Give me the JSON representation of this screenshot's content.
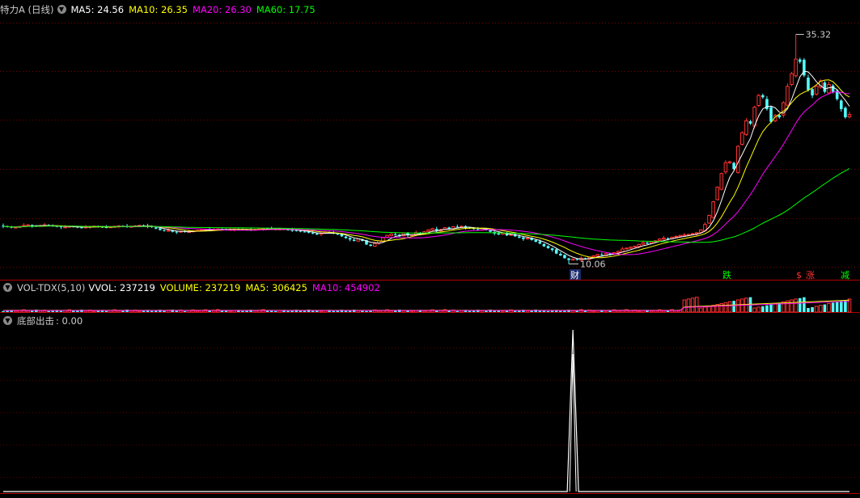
{
  "header": {
    "title": "特力A (日线)",
    "ma5": "MA5: 24.56",
    "ma10": "MA10: 26.35",
    "ma20": "MA20: 26.30",
    "ma60": "MA60: 17.75",
    "colors": {
      "text": "#cccccc",
      "ma5": "#ffffff",
      "ma10": "#ffff00",
      "ma20": "#ff00ff",
      "ma60": "#00ff00"
    }
  },
  "vol_header": {
    "name": "VOL-TDX(5,10)",
    "vvol": "VVOL: 237219",
    "volume": "VOLUME: 237219",
    "ma5": "MA5: 306425",
    "ma10": "MA10: 454902"
  },
  "ind_header": {
    "name": "底部出击",
    "value": ": 0.00"
  },
  "annotations": {
    "high": "35.32",
    "low": "10.06",
    "cai": "财",
    "die": "跌",
    "s": "$",
    "zhang": "涨",
    "jian": "减"
  },
  "icons": {
    "dropdown": "chevron-down-icon"
  },
  "chart_data": [
    {
      "type": "candlestick",
      "ylim": [
        8.5,
        37.5
      ],
      "grid": true,
      "x": [
        0,
        1,
        2,
        3,
        4,
        5,
        6,
        7,
        8,
        9,
        10,
        11,
        12,
        13,
        14,
        15,
        16,
        17,
        18,
        19,
        20,
        21,
        22,
        23,
        24,
        25,
        26,
        27,
        28,
        29,
        30,
        31,
        32,
        33,
        34,
        35,
        36,
        37,
        38,
        39,
        40,
        41,
        42,
        43,
        44,
        45,
        46,
        47,
        48,
        49,
        50,
        51,
        52,
        53,
        54,
        55,
        56,
        57,
        58,
        59,
        60,
        61,
        62,
        63,
        64,
        65,
        66,
        67,
        68,
        69,
        70,
        71,
        72,
        73,
        74,
        75,
        76,
        77,
        78,
        79,
        80,
        81,
        82,
        83,
        84,
        85,
        86,
        87,
        88,
        89,
        90,
        91,
        92,
        93,
        94,
        95,
        96,
        97,
        98,
        99,
        100,
        101,
        102,
        103,
        104,
        105,
        106,
        107,
        108,
        109,
        110,
        111,
        112,
        113,
        114,
        115,
        116,
        117,
        118,
        119,
        120,
        121,
        122,
        123,
        124,
        125,
        126,
        127,
        128,
        129,
        130,
        131,
        132,
        133,
        134,
        135,
        136,
        137,
        138,
        139,
        140,
        141,
        142,
        143,
        144,
        145,
        146,
        147,
        148,
        149,
        150,
        151,
        152,
        153,
        154,
        155,
        156,
        157,
        158,
        159,
        160,
        161,
        162,
        163,
        164,
        165,
        166,
        167,
        168,
        169,
        170,
        171,
        172,
        173,
        174,
        175,
        176,
        177,
        178,
        179,
        180,
        181,
        182,
        183,
        184,
        185,
        186,
        187,
        188,
        189,
        190,
        191,
        192,
        193,
        194,
        195,
        196,
        197,
        198,
        199,
        200,
        201,
        202,
        203,
        204,
        205,
        206,
        207,
        208,
        209
      ],
      "close": [
        14.2,
        14.15,
        14.05,
        14.1,
        14.18,
        14.3,
        14.35,
        14.25,
        14.2,
        14.28,
        14.35,
        14.3,
        14.22,
        14.18,
        14.1,
        14.12,
        14.2,
        14.15,
        14.08,
        14.05,
        14.12,
        14.18,
        14.22,
        14.15,
        14.1,
        14.08,
        14.14,
        14.2,
        14.25,
        14.2,
        14.12,
        14.18,
        14.24,
        14.3,
        14.25,
        14.2,
        14.1,
        13.95,
        13.8,
        13.7,
        13.75,
        13.6,
        13.55,
        13.65,
        13.58,
        13.62,
        13.7,
        13.75,
        13.82,
        13.85,
        13.8,
        13.88,
        13.9,
        13.86,
        13.8,
        13.85,
        13.9,
        13.88,
        13.84,
        13.8,
        13.78,
        13.84,
        13.9,
        13.95,
        13.92,
        13.88,
        13.85,
        13.9,
        13.86,
        13.8,
        13.78,
        13.7,
        13.62,
        13.6,
        13.5,
        13.4,
        13.3,
        13.45,
        13.55,
        13.5,
        13.4,
        13.3,
        13.1,
        12.9,
        12.75,
        12.6,
        12.8,
        12.6,
        12.2,
        12.05,
        12.3,
        12.6,
        12.95,
        13.2,
        13.35,
        13.25,
        13.1,
        13.45,
        13.2,
        13.25,
        13.5,
        13.4,
        13.6,
        13.8,
        13.95,
        13.7,
        13.85,
        14.05,
        13.9,
        14.15,
        14.1,
        14.2,
        14.05,
        14.0,
        13.9,
        13.8,
        13.95,
        13.8,
        13.6,
        13.4,
        13.3,
        13.45,
        13.2,
        13.3,
        13.1,
        12.95,
        12.8,
        12.9,
        12.7,
        12.5,
        12.3,
        12.0,
        11.8,
        11.6,
        11.2,
        11.0,
        10.7,
        10.5,
        10.6,
        10.5,
        10.7,
        10.6,
        10.8,
        10.95,
        11.1,
        11.0,
        11.2,
        11.15,
        11.3,
        11.45,
        11.7,
        11.8,
        11.9,
        12.0,
        12.2,
        12.4,
        12.3,
        12.5,
        12.6,
        12.8,
        12.9,
        12.85,
        13.0,
        13.1,
        13.2,
        13.25,
        13.3,
        13.4,
        13.5,
        13.8,
        14.4,
        15.4,
        16.9,
        18.5,
        20.0,
        21.2,
        21.3,
        20.5,
        23.0,
        24.5,
        25.8,
        25.5,
        27.3,
        28.6,
        28.4,
        27.1,
        25.7,
        26.4,
        26.2,
        27.8,
        29.6,
        31.0,
        32.6,
        32.3,
        30.8,
        29.2,
        28.6,
        29.6,
        30.2,
        29.0,
        29.8,
        29.0,
        28.2,
        27.1,
        26.2,
        26.5
      ],
      "indicator_lines": [
        "MA5",
        "MA10",
        "MA20",
        "MA60"
      ]
    },
    {
      "type": "bar",
      "title": "VOL-TDX(5,10)",
      "series": [
        {
          "name": "VOLUME",
          "values": []
        },
        {
          "name": "MA5",
          "values": []
        },
        {
          "name": "MA10",
          "values": []
        }
      ]
    },
    {
      "type": "line",
      "title": "底部出击",
      "ylim": [
        0,
        1
      ],
      "series": [
        {
          "name": "底部出击",
          "peak_index": 138,
          "values": []
        }
      ]
    }
  ]
}
